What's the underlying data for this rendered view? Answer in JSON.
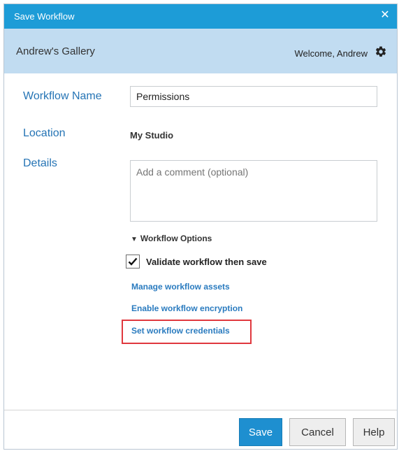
{
  "dialog": {
    "title": "Save Workflow",
    "close_glyph": "✕"
  },
  "header": {
    "gallery_name": "Andrew's Gallery",
    "welcome_text": "Welcome, Andrew",
    "settings_icon": "gear-icon"
  },
  "form": {
    "workflow_name_label": "Workflow Name",
    "workflow_name_value": "Permissions",
    "location_label": "Location",
    "location_value": "My Studio",
    "details_label": "Details",
    "details_placeholder": "Add a comment (optional)"
  },
  "options": {
    "header": "Workflow Options",
    "expanded_icon": "triangle-down-icon",
    "validate_label": "Validate workflow then save",
    "validate_checked": true,
    "links": {
      "manage_assets": "Manage workflow assets",
      "enable_encryption": "Enable workflow encryption",
      "set_credentials": "Set workflow credentials"
    },
    "highlight_color": "#e0383e"
  },
  "buttons": {
    "save": "Save",
    "cancel": "Cancel",
    "help": "Help"
  },
  "colors": {
    "titlebar": "#1d9cd7",
    "headerbar": "#c1dcf1",
    "label_blue": "#2574b5",
    "link_blue": "#2a7bbf",
    "save_button": "#1e8fd0"
  }
}
